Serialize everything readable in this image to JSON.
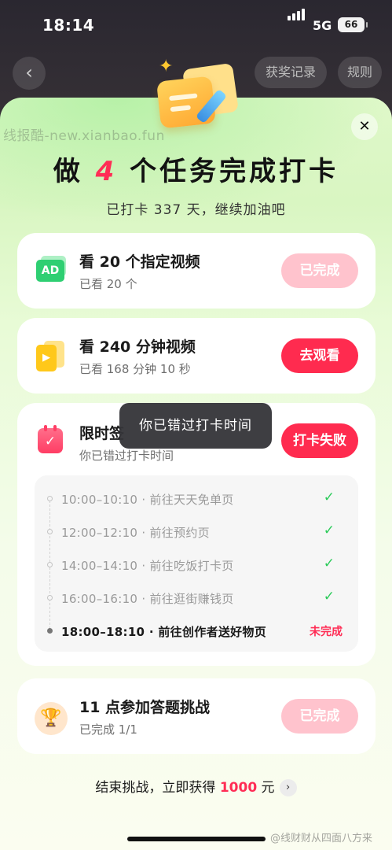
{
  "status_bar": {
    "time": "18:14",
    "network": "5G",
    "battery": "66"
  },
  "top_nav": {
    "back_icon": "chevron-left-icon",
    "records": "获奖记录",
    "rules": "规则"
  },
  "watermark": "线报酷-new.xianbao.fun",
  "sheet": {
    "close_icon": "close-icon",
    "title": {
      "pre": "做 ",
      "num": "4",
      "mid": " 个任务",
      "swash": "完成打卡"
    },
    "subtitle": "已打卡 337 天，继续加油吧"
  },
  "tasks": [
    {
      "icon": "ad-icon",
      "icon_text": "AD",
      "title": "看 20 个指定视频",
      "status": "已看 20 个",
      "button": "已完成",
      "button_state": "done"
    },
    {
      "icon": "video-play-icon",
      "title": "看 240 分钟视频",
      "status": "已看 168 分钟 10 秒",
      "button": "去观看",
      "button_state": "active"
    },
    {
      "icon": "calendar-check-icon",
      "title": "限时签",
      "status": "你已错过打卡时间",
      "button": "打卡失败",
      "button_state": "active"
    },
    {
      "icon": "trophy-icon",
      "title": "11 点参加答题挑战",
      "status": "已完成 1/1",
      "button": "已完成",
      "button_state": "done"
    }
  ],
  "schedule": [
    {
      "text": "10:00–10:10 · 前往天天免单页",
      "mark": "✓"
    },
    {
      "text": "12:00–12:10 · 前往预约页",
      "mark": "✓"
    },
    {
      "text": "14:00–14:10 · 前往吃饭打卡页",
      "mark": "✓"
    },
    {
      "text": "16:00–16:10 · 前往逛街赚钱页",
      "mark": "✓"
    },
    {
      "text": "18:00–18:10 · 前往创作者送好物页",
      "mark": "未完成"
    }
  ],
  "toast": "你已错过打卡时间",
  "footer": {
    "pre": "结束挑战，立即获得 ",
    "amount": "1000",
    "post": " 元"
  },
  "credit": "@线财财从四面八方来",
  "colors": {
    "accent_red": "#ff2b4f",
    "done_pink": "#ffc3cd",
    "check_green": "#2ccb5a",
    "sheet_green": "#dff8c9"
  }
}
